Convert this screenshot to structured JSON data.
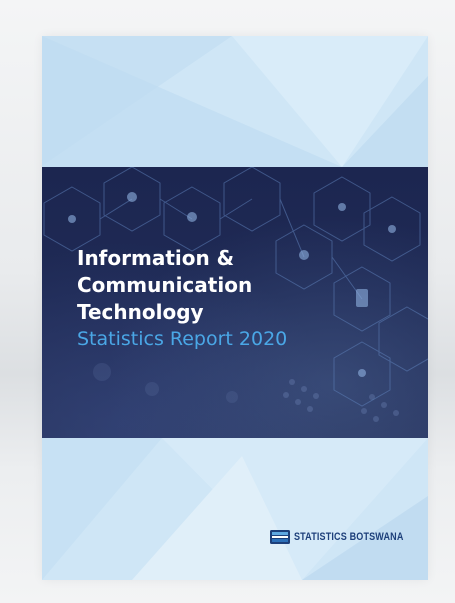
{
  "document": {
    "title_lines": [
      "Information &",
      "Communication",
      "Technology"
    ],
    "subtitle": "Statistics Report 2020",
    "publisher": "STATISTICS BOTSWANA"
  },
  "colors": {
    "title": "#ffffff",
    "subtitle": "#4aa7e6",
    "band": "#1f2a55",
    "cover_background": "#cfe6f6",
    "publisher": "#1d3f7a"
  },
  "icons": {
    "publisher_logo": "statistics-botswana-logo-icon"
  }
}
